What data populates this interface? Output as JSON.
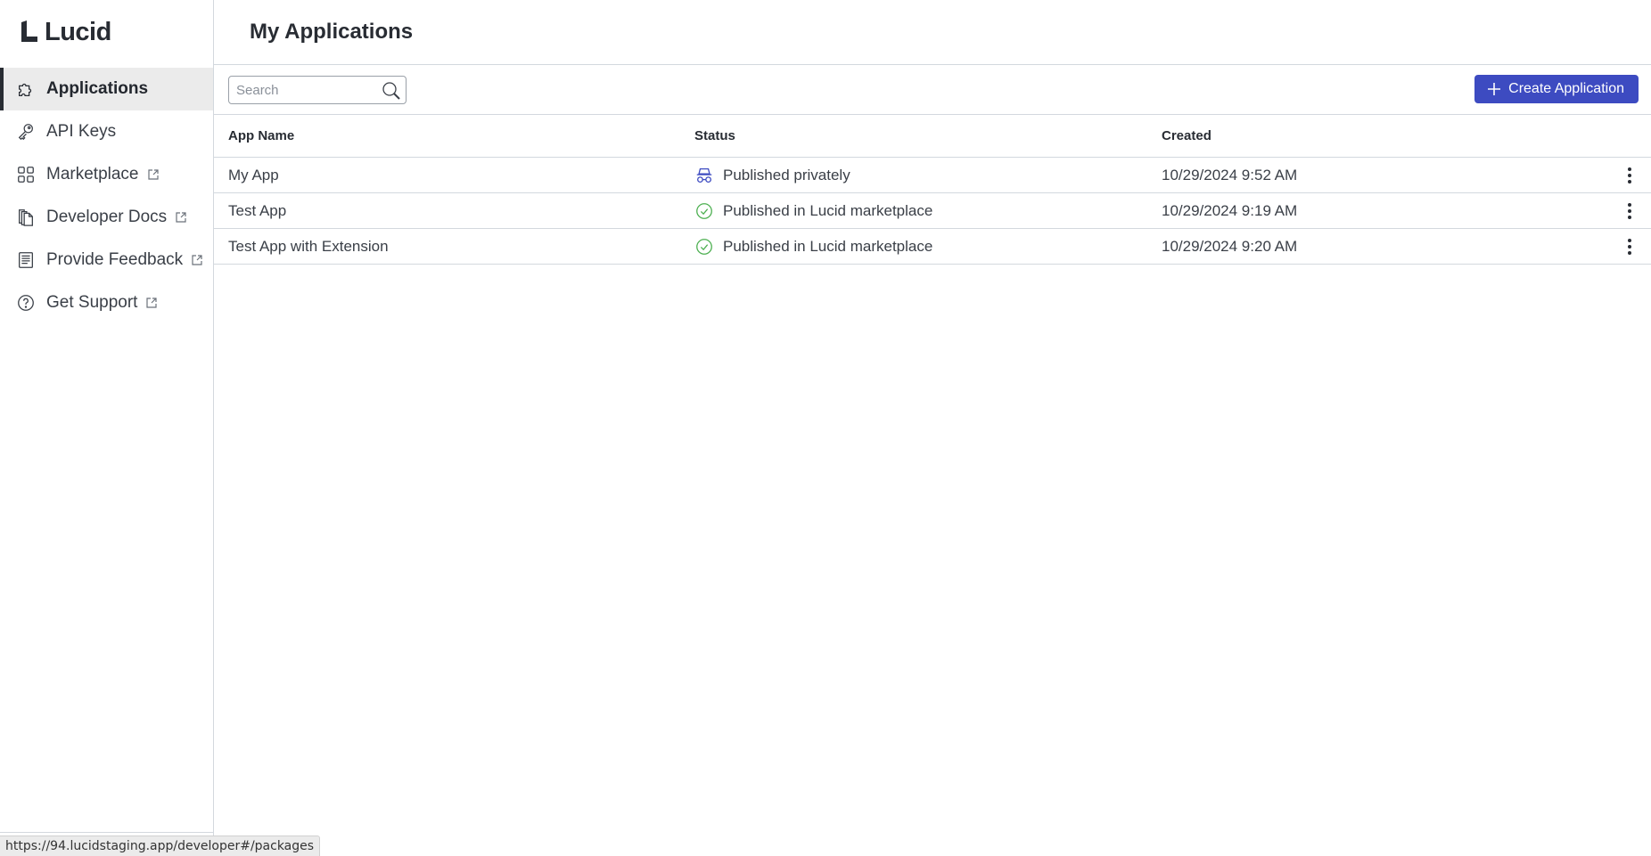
{
  "brand": {
    "name": "Lucid"
  },
  "sidebar": {
    "items": [
      {
        "label": "Applications",
        "icon": "puzzle-icon",
        "external": false,
        "active": true
      },
      {
        "label": "API Keys",
        "icon": "key-icon",
        "external": false,
        "active": false
      },
      {
        "label": "Marketplace",
        "icon": "grid-icon",
        "external": true,
        "active": false
      },
      {
        "label": "Developer Docs",
        "icon": "documents-icon",
        "external": true,
        "active": false
      },
      {
        "label": "Provide Feedback",
        "icon": "feedback-icon",
        "external": true,
        "active": false
      },
      {
        "label": "Get Support",
        "icon": "help-icon",
        "external": true,
        "active": false
      }
    ]
  },
  "header": {
    "title": "My Applications"
  },
  "toolbar": {
    "search_placeholder": "Search",
    "search_value": "",
    "create_label": "Create Application"
  },
  "table": {
    "columns": [
      "App Name",
      "Status",
      "Created"
    ],
    "rows": [
      {
        "name": "My App",
        "status": "Published privately",
        "status_icon": "incognito-icon",
        "created": "10/29/2024 9:52 AM"
      },
      {
        "name": "Test App",
        "status": "Published in Lucid marketplace",
        "status_icon": "check-circle-icon",
        "created": "10/29/2024 9:19 AM"
      },
      {
        "name": "Test App with Extension",
        "status": "Published in Lucid marketplace",
        "status_icon": "check-circle-icon",
        "created": "10/29/2024 9:20 AM"
      }
    ]
  },
  "colors": {
    "primary": "#3d4bc1",
    "success": "#4caf50",
    "private": "#3d4bc1",
    "text": "#282c33",
    "border": "#d3d8de"
  },
  "statusbar": {
    "url": "https://94.lucidstaging.app/developer#/packages"
  }
}
